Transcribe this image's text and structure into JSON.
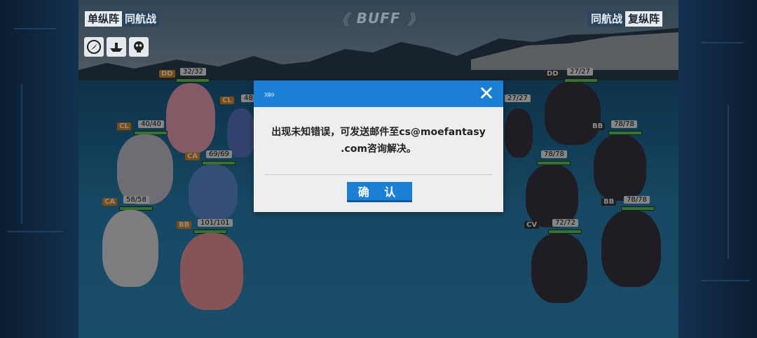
{
  "formation_left": {
    "active": "单纵阵",
    "inactive": "同航战"
  },
  "formation_right": {
    "inactive": "同航战",
    "active": "复纵阵"
  },
  "buff_label": "BUFF",
  "status_icons": [
    "compass-icon",
    "ship-emblem-icon",
    "skull-emblem-icon"
  ],
  "allies": [
    {
      "cls": "DD",
      "hp": "32/32",
      "color": "#f0a4b9"
    },
    {
      "cls": "CL",
      "hp": "40/40",
      "color": "#c9c6d3"
    },
    {
      "cls": "CL",
      "hp": "48",
      "color": "#5a78c8"
    },
    {
      "cls": "CA",
      "hp": "69/69",
      "color": "#5f8fd8"
    },
    {
      "cls": "CA",
      "hp": "58/58",
      "color": "#e3e3ea"
    },
    {
      "cls": "BB",
      "hp": "101/101",
      "color": "#f29aa0"
    }
  ],
  "enemies": [
    {
      "cls": "DD",
      "hp": "27/27"
    },
    {
      "cls": "",
      "hp": "27/27"
    },
    {
      "cls": "BB",
      "hp": "78/78"
    },
    {
      "cls": "",
      "hp": "78/78"
    },
    {
      "cls": "BB",
      "hp": "78/78"
    },
    {
      "cls": "CV",
      "hp": "72/72"
    }
  ],
  "dialog": {
    "message_line1": "出现未知错误，可发送邮件至cs@moefantasy",
    "message_line2": ".com咨询解决。",
    "confirm_label": "确 认"
  }
}
